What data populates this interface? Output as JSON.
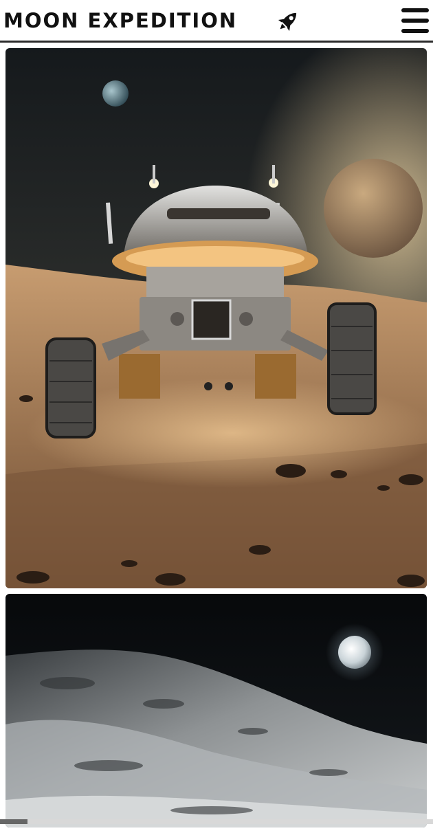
{
  "header": {
    "title": "MOON EXPEDITION",
    "icon": "rocket-icon",
    "menu_icon": "hamburger-menu-icon"
  },
  "gallery": {
    "images": [
      {
        "name": "moon-lander-image",
        "depicts": "lander-on-lunar-surface"
      },
      {
        "name": "lunar-landscape-image",
        "depicts": "earth-over-lunar-hills"
      }
    ]
  },
  "colors": {
    "header_bg": "#ffffff",
    "text": "#111111",
    "header_border": "#2b2b2b"
  }
}
